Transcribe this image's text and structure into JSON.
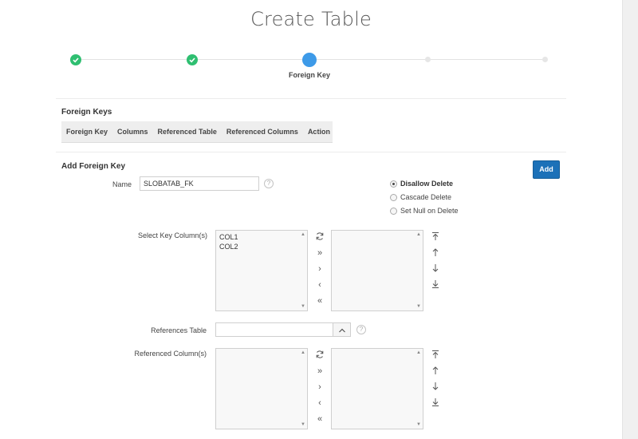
{
  "page": {
    "title": "Create Table"
  },
  "wizard": {
    "steps": [
      {
        "state": "done",
        "label": ""
      },
      {
        "state": "done",
        "label": ""
      },
      {
        "state": "current",
        "label": "Foreign Key"
      },
      {
        "state": "todo",
        "label": ""
      },
      {
        "state": "todo",
        "label": ""
      }
    ]
  },
  "foreign_keys": {
    "title": "Foreign Keys",
    "columns": [
      "Foreign Key",
      "Columns",
      "Referenced Table",
      "Referenced Columns",
      "Action"
    ]
  },
  "add_fk": {
    "title": "Add Foreign Key",
    "add_label": "Add",
    "name_label": "Name",
    "name_value": "SLOBATAB_FK",
    "help_glyph": "?",
    "options": [
      "Disallow Delete",
      "Cascade Delete",
      "Set Null on Delete"
    ],
    "selected_option": "Disallow Delete",
    "key_columns_label": "Select Key Column(s)",
    "key_columns_available": [
      "COL1",
      "COL2"
    ],
    "key_columns_selected": [],
    "references_table_label": "References Table",
    "references_table_value": "",
    "referenced_columns_label": "Referenced Column(s)",
    "referenced_columns_available": [],
    "referenced_columns_selected": []
  },
  "icons": {
    "wizard_done": "check-icon",
    "shuttle": [
      "reset-icon",
      "move-all-icon",
      "move-icon",
      "remove-icon",
      "remove-all-icon"
    ],
    "order": [
      "move-top-icon",
      "move-up-icon",
      "move-down-icon",
      "move-bottom-icon"
    ]
  },
  "colors": {
    "done": "#2fbf71",
    "current": "#3d9ae8",
    "button": "#1c71b8"
  }
}
